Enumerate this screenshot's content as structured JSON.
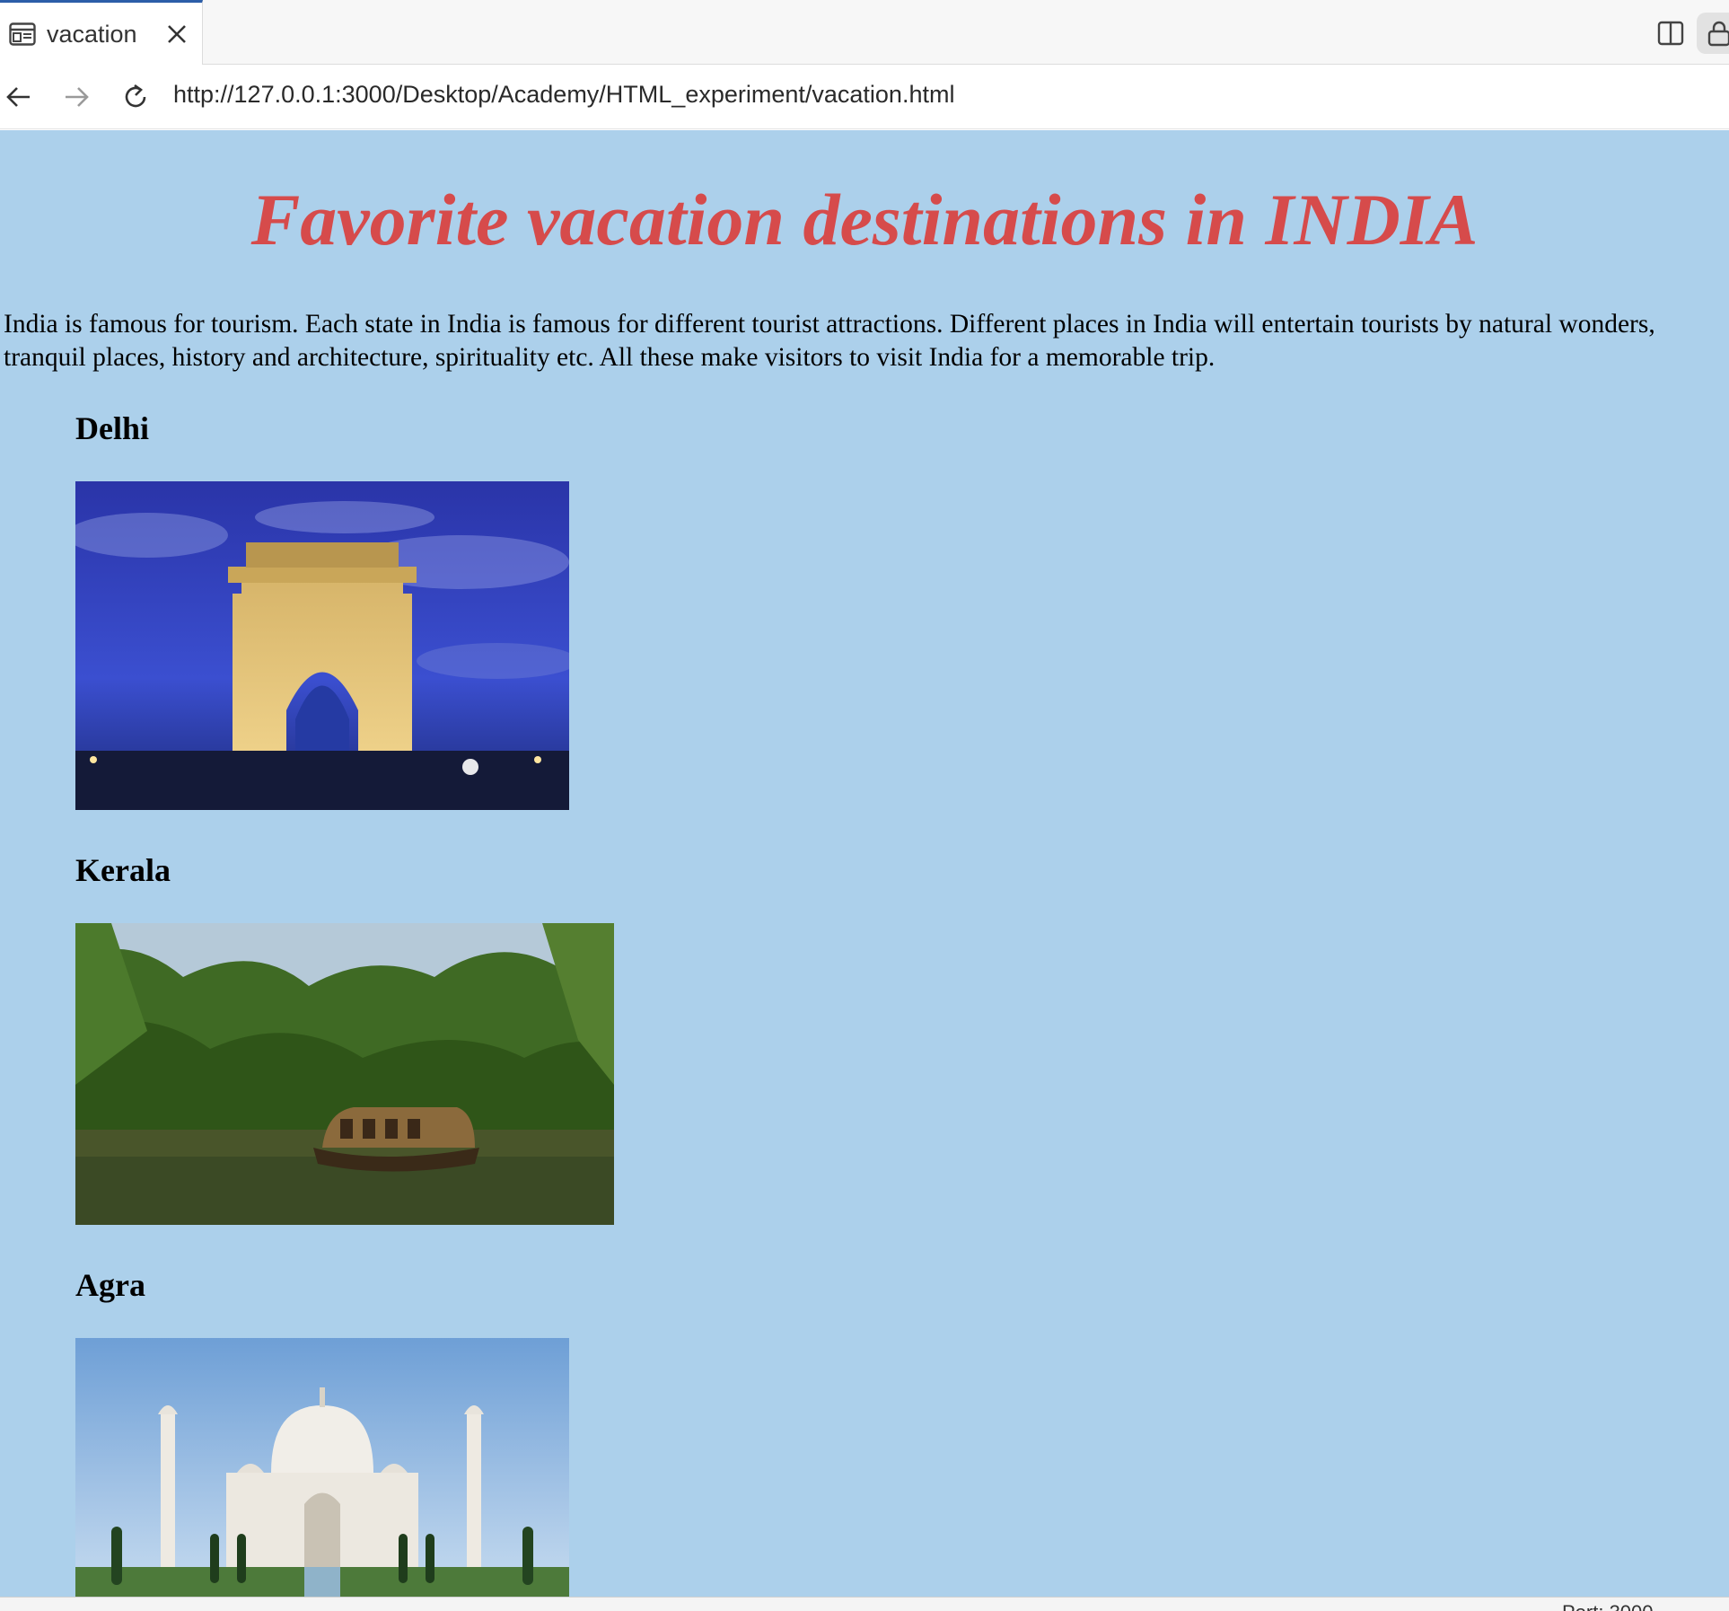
{
  "browser": {
    "tab": {
      "title": "vacation",
      "icon": "page-icon"
    },
    "url": "http://127.0.0.1:3000/Desktop/Academy/HTML_experiment/vacation.html",
    "status_text": "Port: 3000"
  },
  "page": {
    "background_color": "#acd0eb",
    "title": "Favorite vacation destinations in INDIA",
    "title_color": "#d64b4b",
    "intro": "India is famous for tourism. Each state in India is famous for different tourist attractions. Different places in India will entertain tourists by natural wonders, tranquil places, history and architecture, spirituality etc. All these make visitors to visit India for a memorable trip.",
    "destinations": [
      {
        "name": "Delhi",
        "image": "india-gate-photo"
      },
      {
        "name": "Kerala",
        "image": "kerala-backwaters-houseboat-photo"
      },
      {
        "name": "Agra",
        "image": "taj-mahal-photo"
      }
    ]
  }
}
